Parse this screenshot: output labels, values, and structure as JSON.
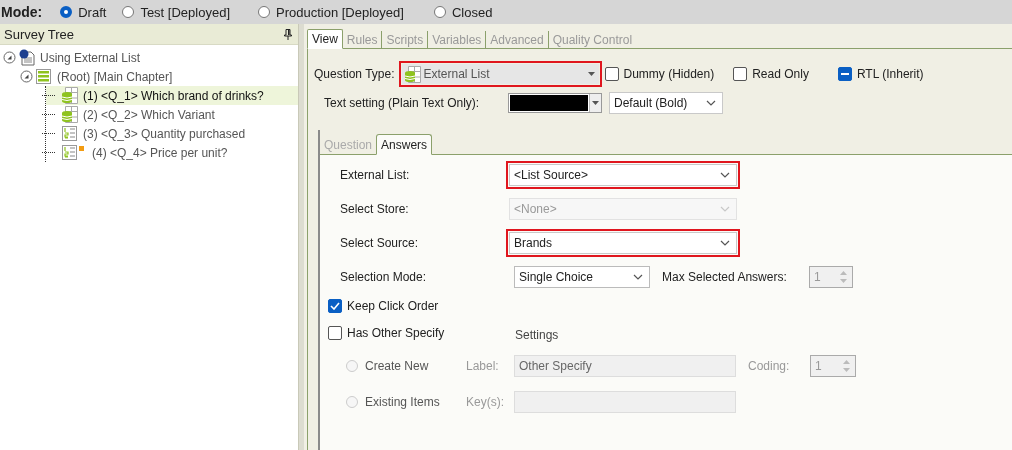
{
  "mode": {
    "label": "Mode:",
    "options": [
      {
        "label": "Draft",
        "selected": true
      },
      {
        "label": "Test [Deployed]",
        "selected": false
      },
      {
        "label": "Production [Deployed]",
        "selected": false
      },
      {
        "label": "Closed",
        "selected": false
      }
    ]
  },
  "survey_tree": {
    "title": "Survey Tree",
    "items": [
      {
        "label": "Using External List",
        "kind": "survey",
        "expanded": true,
        "selected": false,
        "children": [
          {
            "label": "(Root) [Main Chapter]",
            "kind": "chapter",
            "expanded": true,
            "selected": false,
            "children": [
              {
                "label": "(1) <Q_1> Which brand of drinks?",
                "kind": "list",
                "selected": true,
                "flagged": false
              },
              {
                "label": "(2) <Q_2> Which Variant",
                "kind": "list",
                "selected": false,
                "flagged": false
              },
              {
                "label": "(3) <Q_3> Quantity purchased",
                "kind": "numeric",
                "selected": false,
                "flagged": false
              },
              {
                "label": "(4) <Q_4> Price per unit?",
                "kind": "numeric",
                "selected": false,
                "flagged": true
              }
            ]
          }
        ]
      }
    ]
  },
  "tabs": [
    {
      "label": "View",
      "selected": true
    },
    {
      "label": "Rules",
      "selected": false
    },
    {
      "label": "Scripts",
      "selected": false
    },
    {
      "label": "Variables",
      "selected": false
    },
    {
      "label": "Advanced",
      "selected": false
    },
    {
      "label": "Quality Control",
      "selected": false
    }
  ],
  "question_type": {
    "label": "Question Type:",
    "value": "External List",
    "highlighted": true
  },
  "options": [
    {
      "label": "Dummy (Hidden)",
      "checked": false,
      "indeterminate": false
    },
    {
      "label": "Read Only",
      "checked": false,
      "indeterminate": false
    },
    {
      "label": "RTL (Inherit)",
      "checked": true,
      "indeterminate": true
    }
  ],
  "text_setting": {
    "label": "Text setting (Plain Text Only):",
    "color": "#000000",
    "font": "Default (Bold)"
  },
  "answer_tabs": [
    {
      "label": "Question",
      "selected": false
    },
    {
      "label": "Answers",
      "selected": true
    }
  ],
  "answer_fields": [
    {
      "label": "External List:",
      "value": "<List Source>",
      "disabled": false,
      "highlighted": true
    },
    {
      "label": "Select Store:",
      "value": "<None>",
      "disabled": true,
      "highlighted": false
    },
    {
      "label": "Select Source:",
      "value": "Brands",
      "disabled": false,
      "highlighted": true
    }
  ],
  "selection_mode": {
    "label": "Selection Mode:",
    "value": "Single Choice",
    "max_label": "Max Selected Answers:",
    "max_value": "1",
    "max_disabled": true
  },
  "keep_click_order": {
    "label": "Keep Click Order",
    "checked": true
  },
  "other_specify": {
    "label": "Has Other Specify",
    "checked": false,
    "settings_label": "Settings",
    "choices": [
      {
        "label": "Create New",
        "selected": false,
        "disabled": true,
        "field_label": "Label:",
        "field_value": "Other Specify",
        "coding_label": "Coding:",
        "coding_value": "1"
      },
      {
        "label": "Existing Items",
        "selected": false,
        "disabled": true,
        "field_label": "Key(s):"
      }
    ]
  }
}
